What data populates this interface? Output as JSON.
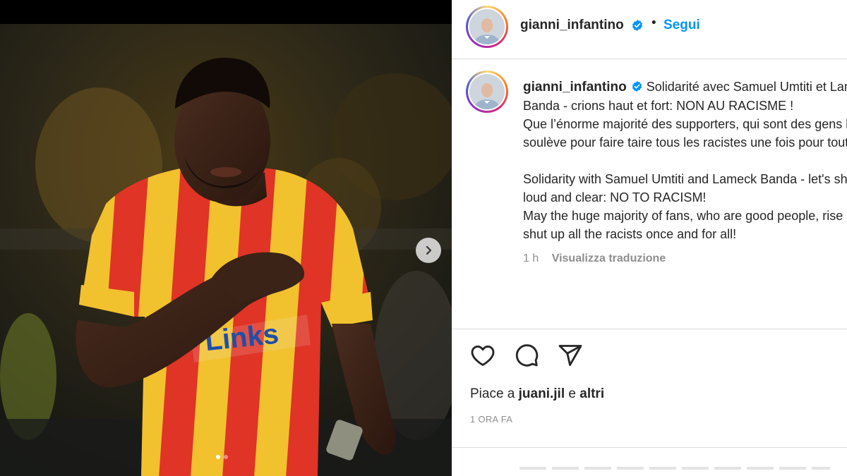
{
  "post": {
    "author": "gianni_infantino",
    "follow_label": "Segui",
    "separator": "•",
    "caption_lines_fr": [
      "Solidarité avec Samuel Umtiti et Lameck",
      "Banda - crions haut et fort: NON AU RACISME !",
      "Que l’énorme majorité des supporters, qui sont des gens bien, se",
      "soulève pour faire taire tous les racistes une fois pour toutes !"
    ],
    "caption_lines_en": [
      "Solidarity with Samuel Umtiti and Lameck Banda - let's shout it",
      "loud and clear: NO TO RACISM!",
      "May the huge majority of fans, who are good people, rise up to",
      "shut up all the racists once and for all!"
    ],
    "caption_time": "1 h",
    "translate_label": "Visualizza traduzione",
    "likes_prefix": "Piace a",
    "likes_user": "juani.jil",
    "likes_suffix_joiner": "e",
    "likes_suffix": "altri",
    "time_ago": "1 ORA FA",
    "carousel": {
      "total_slides": 2,
      "active_slide": 1
    }
  },
  "icons": {
    "verified": "verified-badge-icon",
    "like": "heart-icon",
    "comment": "comment-icon",
    "share": "send-icon",
    "next": "chevron-right-icon"
  },
  "colors": {
    "link_blue": "#0095f6",
    "verified_blue": "#0095f6",
    "text": "#262626",
    "muted": "#8e8e8e",
    "divider": "#dbdbdb"
  }
}
